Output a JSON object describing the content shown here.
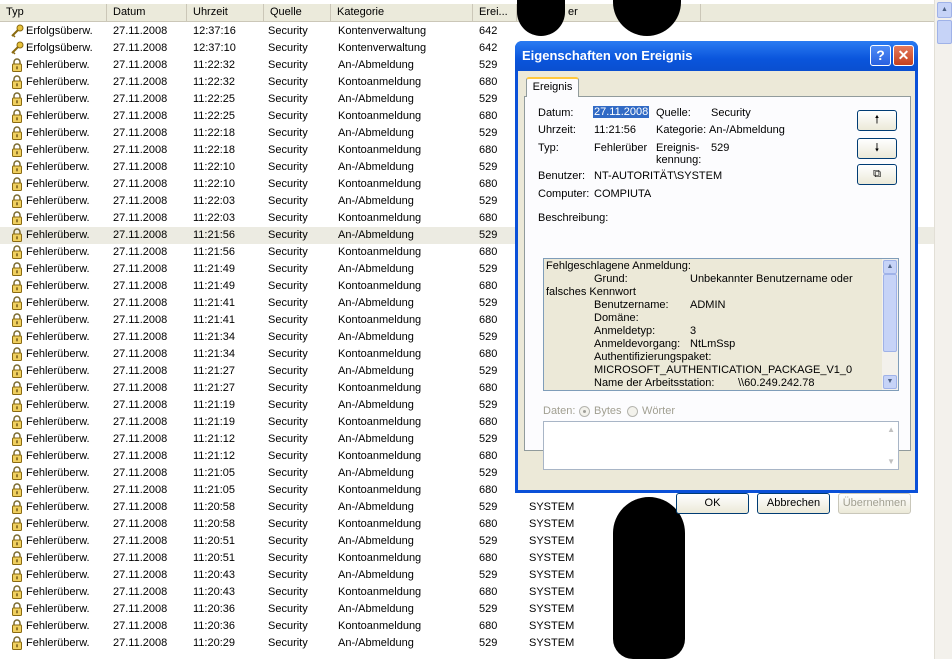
{
  "columns": [
    "Typ",
    "Datum",
    "Uhrzeit",
    "Quelle",
    "Kategorie",
    "Erei...",
    "",
    "er"
  ],
  "rows": [
    {
      "type": "Erfolgsüberw.",
      "icon": "key",
      "date": "27.11.2008",
      "time": "12:37:16",
      "source": "Security",
      "category": "Kontenverwaltung",
      "id": "642",
      "user": ""
    },
    {
      "type": "Erfolgsüberw.",
      "icon": "key",
      "date": "27.11.2008",
      "time": "12:37:10",
      "source": "Security",
      "category": "Kontenverwaltung",
      "id": "642",
      "user": ""
    },
    {
      "type": "Fehlerüberw.",
      "icon": "lock",
      "date": "27.11.2008",
      "time": "11:22:32",
      "source": "Security",
      "category": "An-/Abmeldung",
      "id": "529",
      "user": ""
    },
    {
      "type": "Fehlerüberw.",
      "icon": "lock",
      "date": "27.11.2008",
      "time": "11:22:32",
      "source": "Security",
      "category": "Kontoanmeldung",
      "id": "680",
      "user": ""
    },
    {
      "type": "Fehlerüberw.",
      "icon": "lock",
      "date": "27.11.2008",
      "time": "11:22:25",
      "source": "Security",
      "category": "An-/Abmeldung",
      "id": "529",
      "user": ""
    },
    {
      "type": "Fehlerüberw.",
      "icon": "lock",
      "date": "27.11.2008",
      "time": "11:22:25",
      "source": "Security",
      "category": "Kontoanmeldung",
      "id": "680",
      "user": ""
    },
    {
      "type": "Fehlerüberw.",
      "icon": "lock",
      "date": "27.11.2008",
      "time": "11:22:18",
      "source": "Security",
      "category": "An-/Abmeldung",
      "id": "529",
      "user": ""
    },
    {
      "type": "Fehlerüberw.",
      "icon": "lock",
      "date": "27.11.2008",
      "time": "11:22:18",
      "source": "Security",
      "category": "Kontoanmeldung",
      "id": "680",
      "user": ""
    },
    {
      "type": "Fehlerüberw.",
      "icon": "lock",
      "date": "27.11.2008",
      "time": "11:22:10",
      "source": "Security",
      "category": "An-/Abmeldung",
      "id": "529",
      "user": ""
    },
    {
      "type": "Fehlerüberw.",
      "icon": "lock",
      "date": "27.11.2008",
      "time": "11:22:10",
      "source": "Security",
      "category": "Kontoanmeldung",
      "id": "680",
      "user": ""
    },
    {
      "type": "Fehlerüberw.",
      "icon": "lock",
      "date": "27.11.2008",
      "time": "11:22:03",
      "source": "Security",
      "category": "An-/Abmeldung",
      "id": "529",
      "user": ""
    },
    {
      "type": "Fehlerüberw.",
      "icon": "lock",
      "date": "27.11.2008",
      "time": "11:22:03",
      "source": "Security",
      "category": "Kontoanmeldung",
      "id": "680",
      "user": ""
    },
    {
      "type": "Fehlerüberw.",
      "icon": "lock",
      "date": "27.11.2008",
      "time": "11:21:56",
      "source": "Security",
      "category": "An-/Abmeldung",
      "id": "529",
      "user": "",
      "selected": true
    },
    {
      "type": "Fehlerüberw.",
      "icon": "lock",
      "date": "27.11.2008",
      "time": "11:21:56",
      "source": "Security",
      "category": "Kontoanmeldung",
      "id": "680",
      "user": ""
    },
    {
      "type": "Fehlerüberw.",
      "icon": "lock",
      "date": "27.11.2008",
      "time": "11:21:49",
      "source": "Security",
      "category": "An-/Abmeldung",
      "id": "529",
      "user": ""
    },
    {
      "type": "Fehlerüberw.",
      "icon": "lock",
      "date": "27.11.2008",
      "time": "11:21:49",
      "source": "Security",
      "category": "Kontoanmeldung",
      "id": "680",
      "user": ""
    },
    {
      "type": "Fehlerüberw.",
      "icon": "lock",
      "date": "27.11.2008",
      "time": "11:21:41",
      "source": "Security",
      "category": "An-/Abmeldung",
      "id": "529",
      "user": ""
    },
    {
      "type": "Fehlerüberw.",
      "icon": "lock",
      "date": "27.11.2008",
      "time": "11:21:41",
      "source": "Security",
      "category": "Kontoanmeldung",
      "id": "680",
      "user": ""
    },
    {
      "type": "Fehlerüberw.",
      "icon": "lock",
      "date": "27.11.2008",
      "time": "11:21:34",
      "source": "Security",
      "category": "An-/Abmeldung",
      "id": "529",
      "user": ""
    },
    {
      "type": "Fehlerüberw.",
      "icon": "lock",
      "date": "27.11.2008",
      "time": "11:21:34",
      "source": "Security",
      "category": "Kontoanmeldung",
      "id": "680",
      "user": ""
    },
    {
      "type": "Fehlerüberw.",
      "icon": "lock",
      "date": "27.11.2008",
      "time": "11:21:27",
      "source": "Security",
      "category": "An-/Abmeldung",
      "id": "529",
      "user": ""
    },
    {
      "type": "Fehlerüberw.",
      "icon": "lock",
      "date": "27.11.2008",
      "time": "11:21:27",
      "source": "Security",
      "category": "Kontoanmeldung",
      "id": "680",
      "user": ""
    },
    {
      "type": "Fehlerüberw.",
      "icon": "lock",
      "date": "27.11.2008",
      "time": "11:21:19",
      "source": "Security",
      "category": "An-/Abmeldung",
      "id": "529",
      "user": ""
    },
    {
      "type": "Fehlerüberw.",
      "icon": "lock",
      "date": "27.11.2008",
      "time": "11:21:19",
      "source": "Security",
      "category": "Kontoanmeldung",
      "id": "680",
      "user": ""
    },
    {
      "type": "Fehlerüberw.",
      "icon": "lock",
      "date": "27.11.2008",
      "time": "11:21:12",
      "source": "Security",
      "category": "An-/Abmeldung",
      "id": "529",
      "user": ""
    },
    {
      "type": "Fehlerüberw.",
      "icon": "lock",
      "date": "27.11.2008",
      "time": "11:21:12",
      "source": "Security",
      "category": "Kontoanmeldung",
      "id": "680",
      "user": ""
    },
    {
      "type": "Fehlerüberw.",
      "icon": "lock",
      "date": "27.11.2008",
      "time": "11:21:05",
      "source": "Security",
      "category": "An-/Abmeldung",
      "id": "529",
      "user": ""
    },
    {
      "type": "Fehlerüberw.",
      "icon": "lock",
      "date": "27.11.2008",
      "time": "11:21:05",
      "source": "Security",
      "category": "Kontoanmeldung",
      "id": "680",
      "user": ""
    },
    {
      "type": "Fehlerüberw.",
      "icon": "lock",
      "date": "27.11.2008",
      "time": "11:20:58",
      "source": "Security",
      "category": "An-/Abmeldung",
      "id": "529",
      "user": "SYSTEM"
    },
    {
      "type": "Fehlerüberw.",
      "icon": "lock",
      "date": "27.11.2008",
      "time": "11:20:58",
      "source": "Security",
      "category": "Kontoanmeldung",
      "id": "680",
      "user": "SYSTEM"
    },
    {
      "type": "Fehlerüberw.",
      "icon": "lock",
      "date": "27.11.2008",
      "time": "11:20:51",
      "source": "Security",
      "category": "An-/Abmeldung",
      "id": "529",
      "user": "SYSTEM"
    },
    {
      "type": "Fehlerüberw.",
      "icon": "lock",
      "date": "27.11.2008",
      "time": "11:20:51",
      "source": "Security",
      "category": "Kontoanmeldung",
      "id": "680",
      "user": "SYSTEM"
    },
    {
      "type": "Fehlerüberw.",
      "icon": "lock",
      "date": "27.11.2008",
      "time": "11:20:43",
      "source": "Security",
      "category": "An-/Abmeldung",
      "id": "529",
      "user": "SYSTEM"
    },
    {
      "type": "Fehlerüberw.",
      "icon": "lock",
      "date": "27.11.2008",
      "time": "11:20:43",
      "source": "Security",
      "category": "Kontoanmeldung",
      "id": "680",
      "user": "SYSTEM"
    },
    {
      "type": "Fehlerüberw.",
      "icon": "lock",
      "date": "27.11.2008",
      "time": "11:20:36",
      "source": "Security",
      "category": "An-/Abmeldung",
      "id": "529",
      "user": "SYSTEM"
    },
    {
      "type": "Fehlerüberw.",
      "icon": "lock",
      "date": "27.11.2008",
      "time": "11:20:36",
      "source": "Security",
      "category": "Kontoanmeldung",
      "id": "680",
      "user": "SYSTEM"
    },
    {
      "type": "Fehlerüberw.",
      "icon": "lock",
      "date": "27.11.2008",
      "time": "11:20:29",
      "source": "Security",
      "category": "An-/Abmeldung",
      "id": "529",
      "user": "SYSTEM"
    }
  ],
  "dialog": {
    "title": "Eigenschaften von Ereignis",
    "help_label": "?",
    "close_label": "✕",
    "tab_label": "Ereignis",
    "date_label": "Datum:",
    "date_value": "27.11.2008",
    "time_label": "Uhrzeit:",
    "time_value": "11:21:56",
    "type_label": "Typ:",
    "type_value": "Fehlerüber",
    "source_label": "Quelle:",
    "source_value": "Security",
    "category_label": "Kategorie:",
    "category_value": "An-/Abmeldung",
    "event_id_label_1": "Ereignis-",
    "event_id_label_2": "kennung:",
    "event_id_value": "529",
    "user_label": "Benutzer:",
    "user_value": "NT-AUTORITÄT\\SYSTEM",
    "computer_label": "Computer:",
    "computer_value": "COMPIUTA",
    "up_label": "🠕",
    "down_label": "🠗",
    "copy_label": "⧉",
    "description_label": "Beschreibung:",
    "description": {
      "l1": "Fehlgeschlagene Anmeldung:",
      "grund_k": "Grund:",
      "grund_v": "Unbekannter Benutzername oder",
      "l2": "falsches Kennwort",
      "user_k": "Benutzername:",
      "user_v": "ADMIN",
      "domain_k": "Domäne:",
      "type_k": "Anmeldetyp:",
      "type_v": "3",
      "proc_k": "Anmeldevorgang:",
      "proc_v": "NtLmSsp",
      "auth_k": "Authentifizierungspaket:",
      "auth_v": "MICROSOFT_AUTHENTICATION_PACKAGE_V1_0",
      "ws_k": "Name der Arbeitsstation:",
      "ws_v": "\\\\60.249.242.78"
    },
    "data_label": "Daten:",
    "bytes_label": "Bytes",
    "words_label": "Wörter",
    "ok_label": "OK",
    "cancel_label": "Abbrechen",
    "apply_label": "Übernehmen"
  }
}
